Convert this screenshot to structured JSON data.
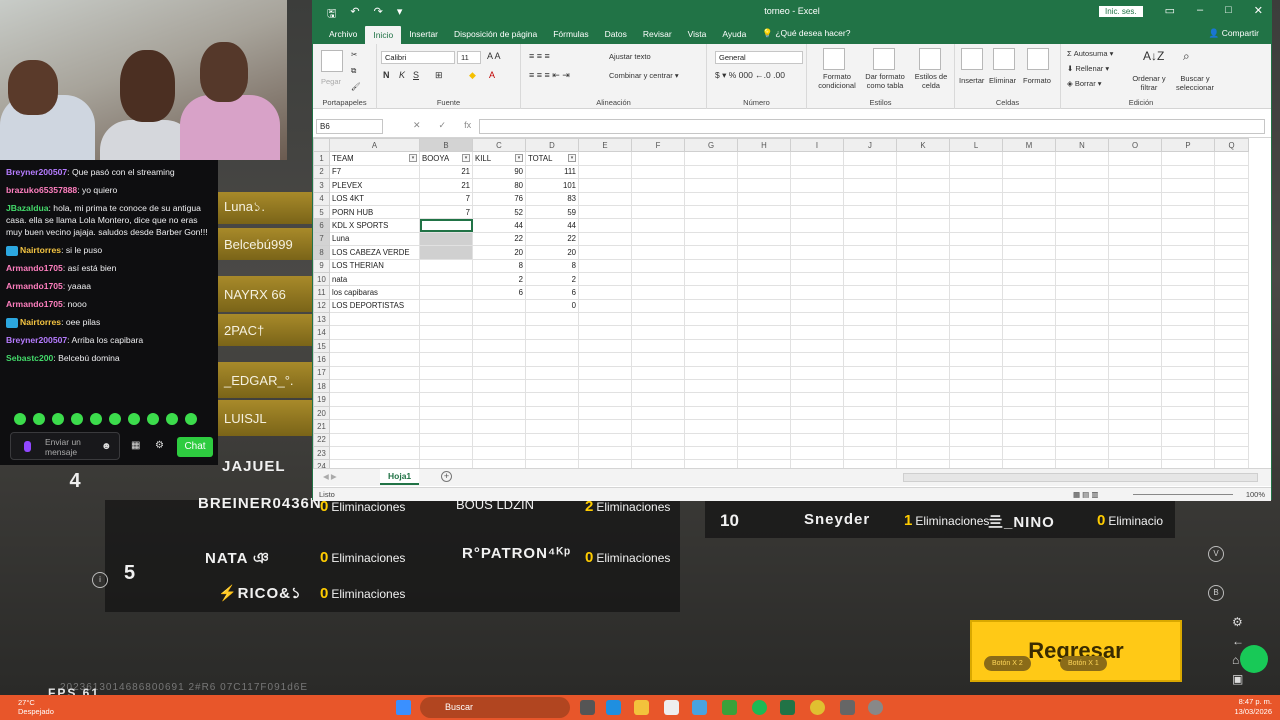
{
  "game": {
    "left_tiles": [
      "Luna১.",
      "Belcebú999",
      "NAYRX  66",
      "2PAC†",
      "_EDGAR_°.",
      "LUISJL",
      "JAJUEL"
    ],
    "rank4": "4",
    "rank4_player": "BREINER0436N",
    "rank4_elim": "Eliminaciones",
    "rank4_p2": "BOUS  LDZIN",
    "rank4_p2_elim_count": "2",
    "rank4_p2_elim": "Eliminaciones",
    "rank4_elim_count": "0",
    "rank5": "5",
    "rank5_p1": "NATA  ঞ",
    "rank5_p1_elim_count": "0",
    "rank5_p1_elim": "Eliminaciones",
    "rank5_p2": "R°PATRON⁴ᴷᵖ",
    "rank5_p2_elim_count": "0",
    "rank5_p2_elim": "Eliminaciones",
    "rank5_p3": "⚡RICO&১",
    "rank5_p3_elim_count": "0",
    "rank5_p3_elim": "Eliminaciones",
    "rank10": "10",
    "rank10_p1": "Sneyder",
    "rank10_p1_elim_count": "1",
    "rank10_p1_elim": "Eliminaciones",
    "rank10_p2": "亖_NINO",
    "rank10_p2_elim_count": "0",
    "rank10_p2_elim": "Eliminacio",
    "regresar": "Regresar",
    "boton_x2": "Botón X 2",
    "boton_x1": "Botón X 1",
    "fps": "FPS  61",
    "hash": "2023613014686800691 2#R6 07C117F091d6E"
  },
  "chat": {
    "messages": [
      {
        "user": "Breyner200507",
        "color": "#b67cff",
        "text": ": Que pasó con el streaming",
        "badge": false
      },
      {
        "user": "brazuko65357888",
        "color": "#ff7fbf",
        "text": ": yo quiero",
        "badge": false
      },
      {
        "user": "JBazaldua",
        "color": "#43d96a",
        "text": ": hola, mi prima te conoce de su antigua casa. ella se llama Lola Montero, dice que no eras muy buen vecino jajaja. saludos desde Barber Gon!!!",
        "badge": false
      },
      {
        "user": "Nairtorres",
        "color": "#f5c542",
        "text": ": si le puso",
        "badge": true
      },
      {
        "user": "Armando1705",
        "color": "#ff7fbf",
        "text": ": así está bien",
        "badge": false
      },
      {
        "user": "Armando1705",
        "color": "#ff7fbf",
        "text": ": yaaaa",
        "badge": false
      },
      {
        "user": "Armando1705",
        "color": "#ff7fbf",
        "text": ": nooo",
        "badge": false
      },
      {
        "user": "Nairtorres",
        "color": "#f5c542",
        "text": ": oee pilas",
        "badge": true
      },
      {
        "user": "Breyner200507",
        "color": "#b67cff",
        "text": ": Arriba los capibara",
        "badge": false
      },
      {
        "user": "Sebastc200",
        "color": "#43d96a",
        "text": ": Belcebú domina",
        "badge": false
      }
    ],
    "input_placeholder": "Enviar un mensaje",
    "chat_button": "Chat"
  },
  "excel": {
    "title": "torneo  -  Excel",
    "signin": "Inic. ses.",
    "menu": [
      "Archivo",
      "Inicio",
      "Insertar",
      "Disposición de página",
      "Fórmulas",
      "Datos",
      "Revisar",
      "Vista",
      "Ayuda"
    ],
    "tell_me": "¿Qué desea hacer?",
    "share": "Compartir",
    "ribbon": {
      "paste": "Pegar",
      "clipboard": "Portapapeles",
      "font_name": "Calibri",
      "font_size": "11",
      "font_group": "Fuente",
      "wrap": "Ajustar texto",
      "merge": "Combinar y centrar",
      "align_group": "Alineación",
      "number_format": "General",
      "number_group": "Número",
      "cond_format": "Formato condicional",
      "table_format": "Dar formato como tabla",
      "cell_styles": "Estilos de celda",
      "styles_group": "Estilos",
      "insert": "Insertar",
      "delete": "Eliminar",
      "format": "Formato",
      "cells_group": "Celdas",
      "autosum": "Autosuma",
      "fill": "Rellenar",
      "clear": "Borrar",
      "sort": "Ordenar y filtrar",
      "find": "Buscar y seleccionar",
      "edit_group": "Edición"
    },
    "name_box": "B6",
    "columns": [
      "A",
      "B",
      "C",
      "D",
      "E",
      "F",
      "G",
      "H",
      "I",
      "J",
      "K",
      "L",
      "M",
      "N",
      "O",
      "P",
      "Q"
    ],
    "headers": [
      "TEAM",
      "BOOYA",
      "KILL",
      "TOTAL"
    ],
    "rows": [
      [
        "F7",
        "21",
        "90",
        "111"
      ],
      [
        "PLEVEX",
        "21",
        "80",
        "101"
      ],
      [
        "LOS 4KT",
        "7",
        "76",
        "83"
      ],
      [
        "PORN HUB",
        "7",
        "52",
        "59"
      ],
      [
        "KDL X SPORTS",
        "",
        "44",
        "44"
      ],
      [
        "Luna",
        "",
        "22",
        "22"
      ],
      [
        "LOS CABEZA VERDE",
        "",
        "20",
        "20"
      ],
      [
        "LOS THERIAN",
        "",
        "8",
        "8"
      ],
      [
        "nata",
        "",
        "2",
        "2"
      ],
      [
        "los capibaras",
        "",
        "6",
        "6"
      ],
      [
        "LOS DEPORTISTAS",
        "",
        "",
        "0"
      ]
    ],
    "row_numbers": [
      "1",
      "2",
      "3",
      "4",
      "5",
      "6",
      "7",
      "8",
      "9",
      "10",
      "11",
      "12",
      "13",
      "14",
      "15",
      "16",
      "17",
      "18",
      "19",
      "20",
      "21",
      "22",
      "23",
      "24"
    ],
    "sheet_tab": "Hoja1",
    "status": "Listo",
    "zoom": "100%"
  },
  "taskbar": {
    "weather_temp": "27°C",
    "weather_desc": "Despejado",
    "search": "Buscar",
    "time": "8:47 p. m.",
    "date": "13/03/2026"
  }
}
